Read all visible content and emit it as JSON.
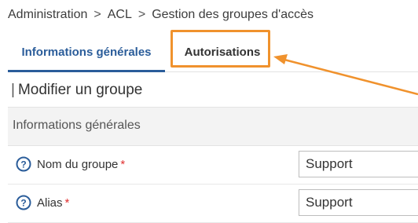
{
  "breadcrumb": {
    "items": [
      "Administration",
      "ACL",
      "Gestion des groupes d'accès"
    ],
    "separator": ">"
  },
  "tabs": [
    {
      "label": "Informations générales",
      "active": true
    },
    {
      "label": "Autorisations",
      "active": false,
      "highlighted": true
    }
  ],
  "page": {
    "title_marker": "|",
    "title": "Modifier un groupe",
    "section_header": "Informations générales"
  },
  "fields": [
    {
      "label": "Nom du groupe",
      "required_mark": "*",
      "value": "Support",
      "icon": "help-circle-icon"
    },
    {
      "label": "Alias",
      "required_mark": "*",
      "value": "Support",
      "icon": "help-circle-icon"
    }
  ],
  "colors": {
    "accent": "#2b5d9a",
    "annotation": "#f0922d",
    "required": "#e03030"
  }
}
